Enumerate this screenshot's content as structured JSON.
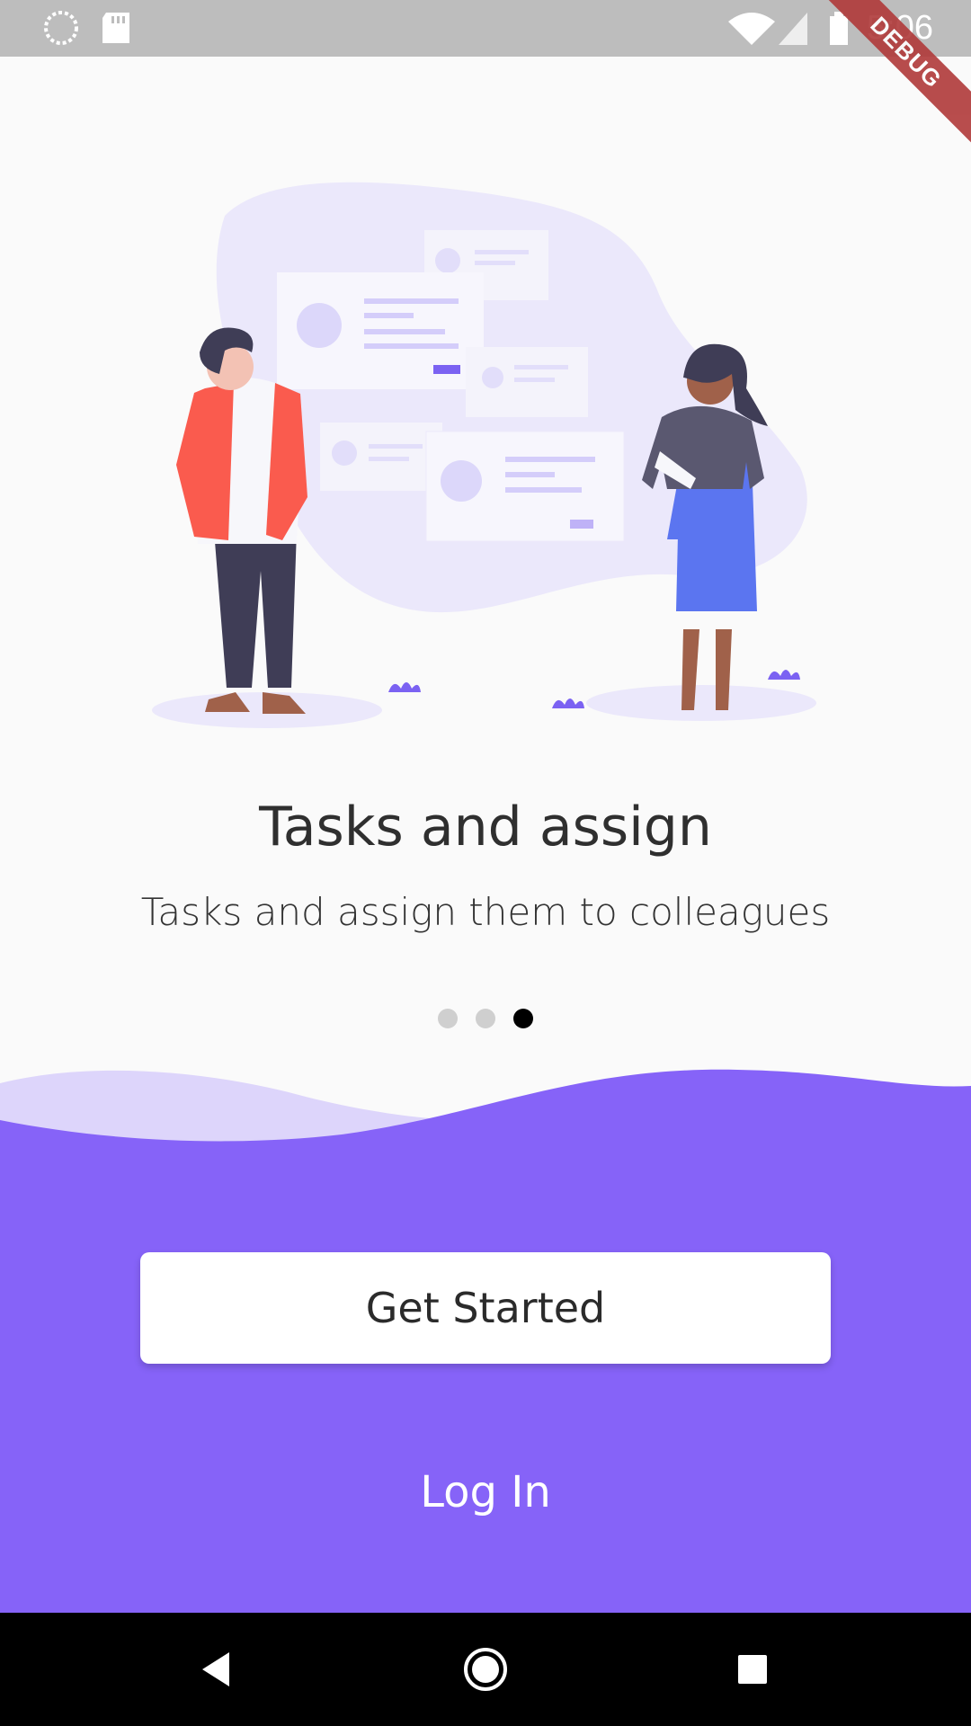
{
  "status_bar": {
    "time": "5:06",
    "debug_label": "DEBUG",
    "icons": [
      "loading-icon",
      "sd-card-icon",
      "wifi-icon",
      "signal-icon",
      "battery-icon"
    ]
  },
  "onboarding": {
    "title": "Tasks and assign",
    "subtitle": "Tasks and assign them to colleagues",
    "page_indicator": {
      "count": 3,
      "active_index": 2
    }
  },
  "actions": {
    "primary_label": "Get Started",
    "secondary_label": "Log In"
  },
  "nav_bar": {
    "icons": [
      "back-icon",
      "home-icon",
      "recents-icon"
    ]
  },
  "colors": {
    "accent": "#8663f8",
    "wave_light": "#ddd5fb",
    "background": "#fafafa"
  }
}
